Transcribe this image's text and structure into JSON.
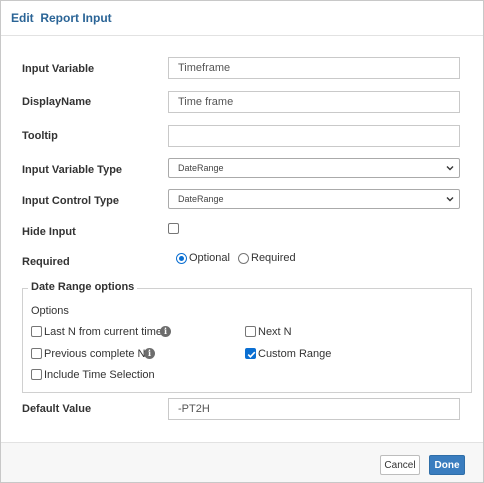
{
  "dialog": {
    "title": "Edit  Report Input"
  },
  "form": {
    "input_variable": {
      "label": "Input Variable",
      "value": "Timeframe"
    },
    "display_name": {
      "label": "DisplayName",
      "value": "Time frame"
    },
    "tooltip": {
      "label": "Tooltip",
      "value": ""
    },
    "input_variable_type": {
      "label": "Input Variable Type",
      "selected": "DateRange"
    },
    "input_control_type": {
      "label": "Input Control Type",
      "selected": "DateRange"
    },
    "hide_input": {
      "label": "Hide Input",
      "checked": false
    },
    "required": {
      "label": "Required",
      "options": [
        {
          "label": "Optional",
          "checked": true
        },
        {
          "label": "Required",
          "checked": false
        }
      ]
    },
    "date_range_options": {
      "legend": "Date Range options",
      "options_label": "Options",
      "items": [
        {
          "label": "Last N from current time",
          "checked": false,
          "info": true
        },
        {
          "label": "Next N",
          "checked": false,
          "info": false
        },
        {
          "label": "Previous complete N",
          "checked": false,
          "info": true
        },
        {
          "label": "Custom Range",
          "checked": true,
          "info": false
        },
        {
          "label": "Include Time Selection",
          "checked": false,
          "info": false
        }
      ]
    },
    "default_value": {
      "label": "Default Value",
      "value": "-PT2H"
    }
  },
  "footer": {
    "cancel_label": "Cancel",
    "done_label": "Done"
  },
  "icons": {
    "info": "info-icon",
    "select_arrow": "chevron-down-icon"
  },
  "colors": {
    "title": "#2a6496",
    "accent": "#0b6fd2",
    "done_button": "#3a7dbf"
  }
}
